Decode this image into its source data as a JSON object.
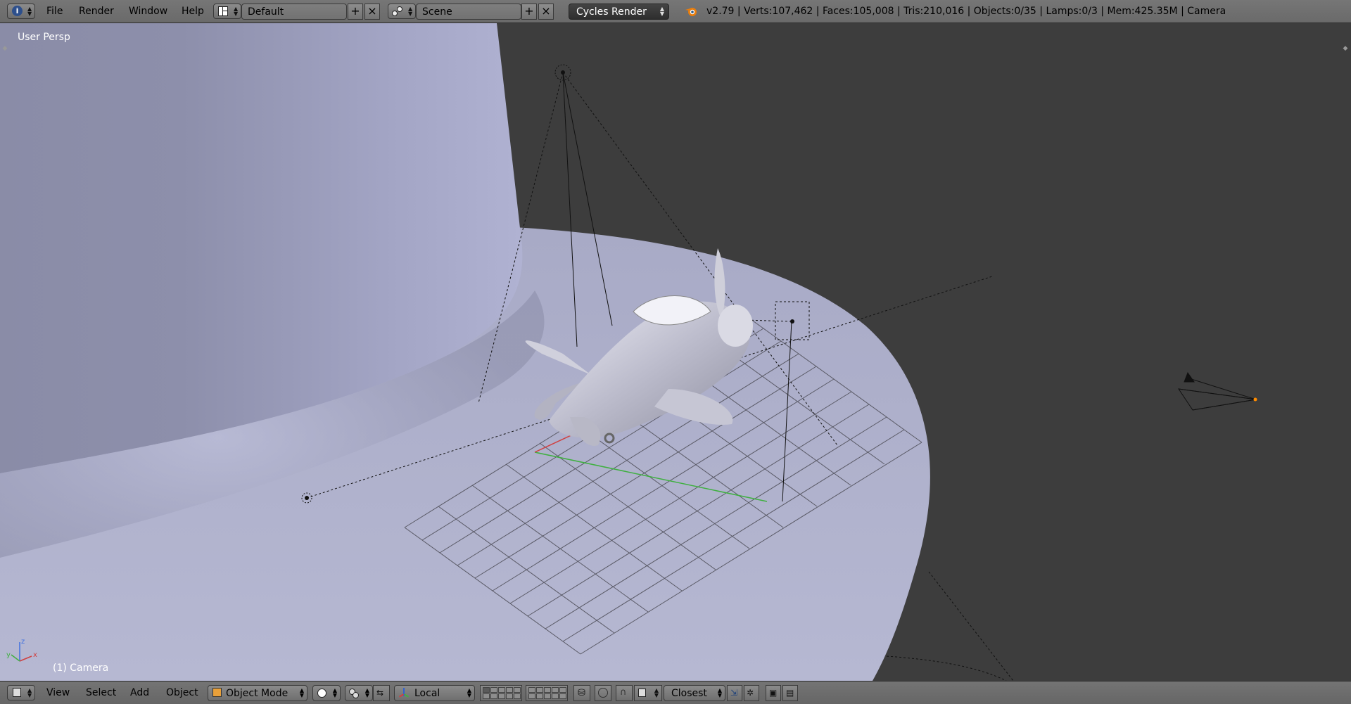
{
  "header": {
    "info_icon": "info-icon",
    "menus": [
      "File",
      "Render",
      "Window",
      "Help"
    ],
    "layout_name": "Default",
    "scene_name": "Scene",
    "render_engine": "Cycles Render",
    "stats": "v2.79 | Verts:107,462 | Faces:105,008 | Tris:210,016 | Objects:0/35 | Lamps:0/3 | Mem:425.35M | Camera"
  },
  "viewport": {
    "view_name": "User Persp",
    "active_object": "(1) Camera",
    "axes": {
      "x": "x",
      "y": "y",
      "z": "z"
    }
  },
  "footer": {
    "menus": [
      "View",
      "Select",
      "Add",
      "Object"
    ],
    "mode": "Object Mode",
    "pivot": "Local",
    "snap_target": "Closest"
  },
  "colors": {
    "ui_gray": "#6e6e6e",
    "viewport_bg": "#3d3d3d",
    "backdrop": "#a9abc8",
    "x_axis": "#d04040",
    "y_axis": "#40b040",
    "z_axis": "#4070e0"
  }
}
